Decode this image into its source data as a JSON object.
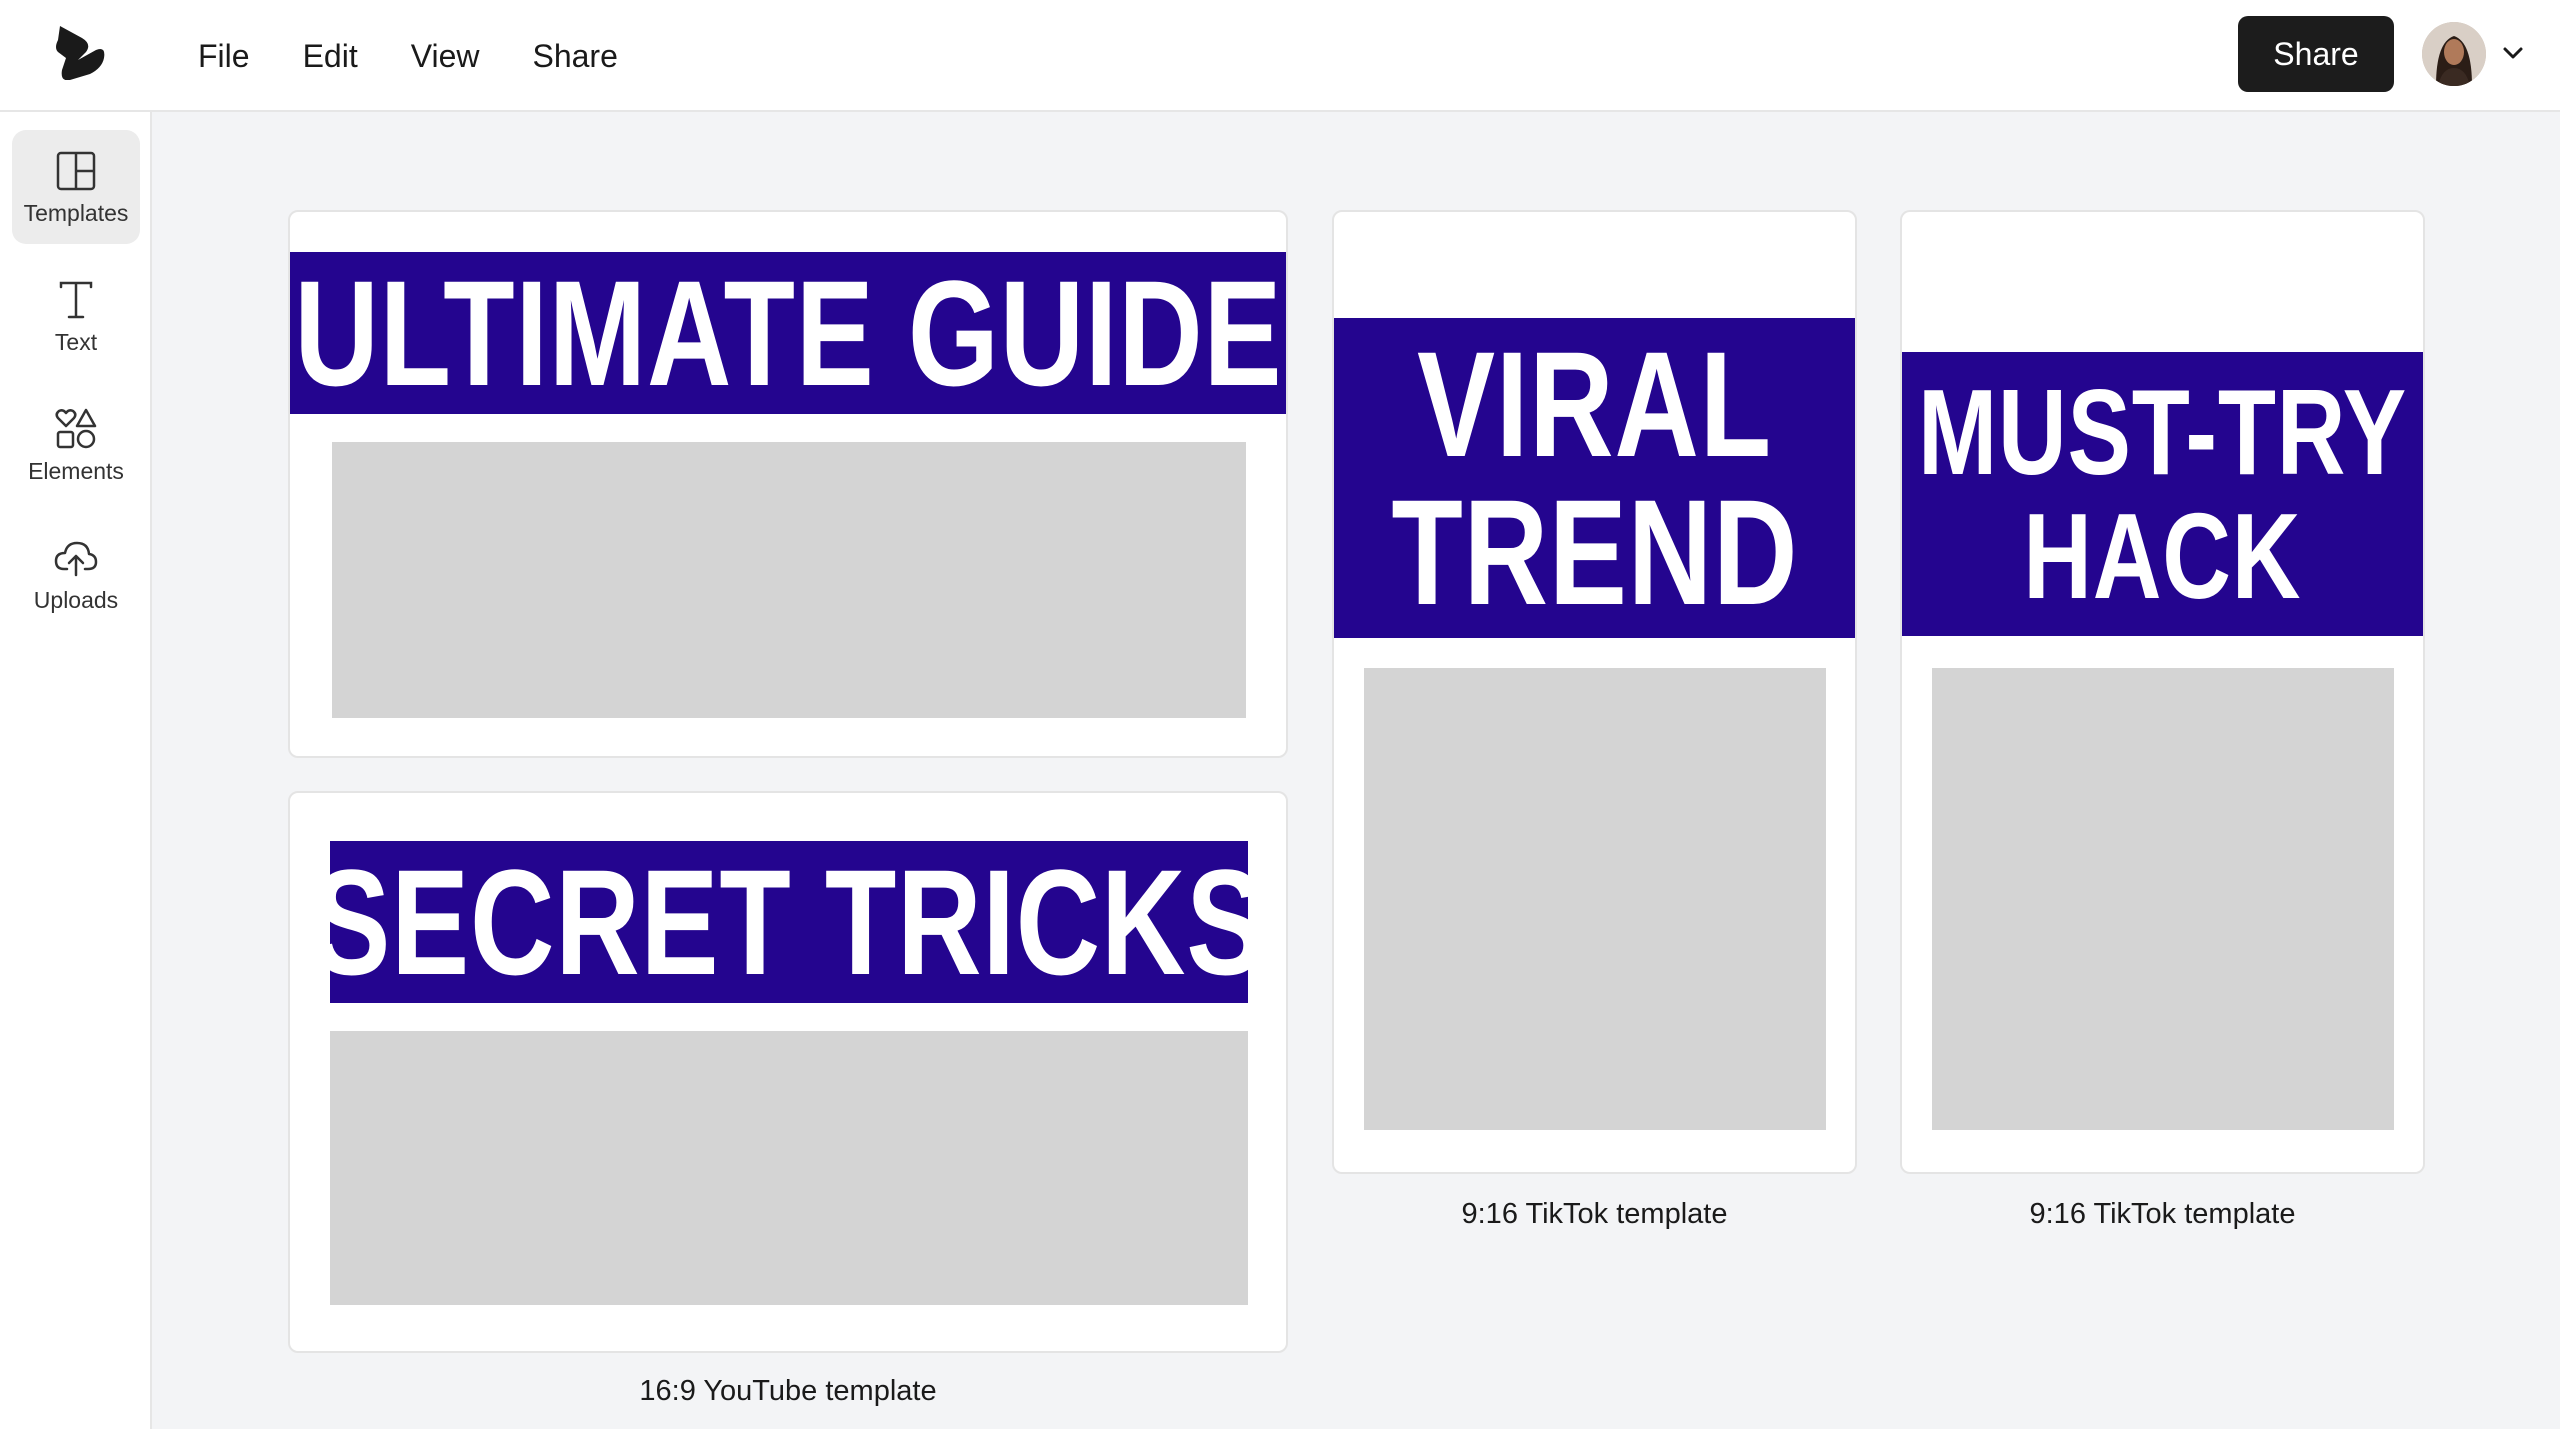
{
  "menu": {
    "items": [
      "File",
      "Edit",
      "View",
      "Share"
    ]
  },
  "header": {
    "share_label": "Share"
  },
  "sidebar": {
    "items": [
      {
        "label": "Templates",
        "icon": "layout-icon",
        "active": true
      },
      {
        "label": "Text",
        "icon": "text-icon",
        "active": false
      },
      {
        "label": "Elements",
        "icon": "shapes-icon",
        "active": false
      },
      {
        "label": "Uploads",
        "icon": "cloud-upload-icon",
        "active": false
      }
    ]
  },
  "templates": {
    "youtube_1_title": "ULTIMATE GUIDE",
    "youtube_2_title": "SECRET TRICKS",
    "youtube_caption": "16:9 YouTube template",
    "tiktok_1_title_line1": "VIRAL",
    "tiktok_1_title_line2": "TREND",
    "tiktok_1_caption": "9:16 TikTok template",
    "tiktok_2_title_line1": "MUST-TRY",
    "tiktok_2_title_line2": "HACK",
    "tiktok_2_caption": "9:16 TikTok template"
  },
  "colors": {
    "banner": "#24058f",
    "placeholder": "#d4d4d4",
    "canvas_bg": "#f3f4f6",
    "share_button": "#1c1c1c"
  }
}
